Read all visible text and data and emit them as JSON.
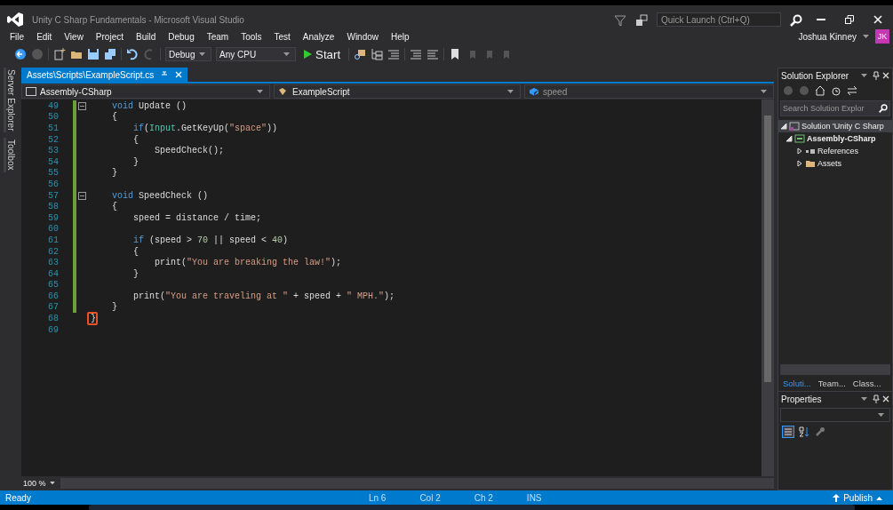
{
  "window": {
    "title": "Unity C Sharp Fundamentals - Microsoft Visual Studio",
    "quick_launch": {
      "placeholder": "Quick Launch (Ctrl+Q)"
    },
    "user": {
      "name": "Joshua Kinney",
      "initials": "JK"
    }
  },
  "menu": [
    "File",
    "Edit",
    "View",
    "Project",
    "Build",
    "Debug",
    "Team",
    "Tools",
    "Test",
    "Analyze",
    "Window",
    "Help"
  ],
  "toolbar": {
    "configuration": "Debug",
    "platform": "Any CPU",
    "start": "Start"
  },
  "side_tabs": [
    "Server Explorer",
    "Toolbox"
  ],
  "editor": {
    "tab": {
      "title": "Assets\\Scripts\\ExampleScript.cs",
      "selected": true
    },
    "nav": {
      "project": "Assembly-CSharp",
      "type": "ExampleScript",
      "member": "speed"
    },
    "lines": [
      {
        "number": "49",
        "fold": true,
        "changed": true,
        "highlighted": false,
        "tokens": [
          {
            "text": "    void",
            "kind": "keyword"
          },
          {
            "text": " Update ()",
            "kind": "plain"
          }
        ]
      },
      {
        "number": "50",
        "fold": false,
        "changed": true,
        "highlighted": false,
        "tokens": [
          {
            "text": "    {",
            "kind": "plain"
          }
        ]
      },
      {
        "number": "51",
        "fold": false,
        "changed": true,
        "highlighted": false,
        "tokens": [
          {
            "text": "        if",
            "kind": "keyword"
          },
          {
            "text": "(",
            "kind": "plain"
          },
          {
            "text": "Input",
            "kind": "type"
          },
          {
            "text": ".GetKeyUp(",
            "kind": "plain"
          },
          {
            "text": "\"space\"",
            "kind": "string"
          },
          {
            "text": "))",
            "kind": "plain"
          }
        ]
      },
      {
        "number": "52",
        "fold": false,
        "changed": true,
        "highlighted": false,
        "tokens": [
          {
            "text": "        {",
            "kind": "plain"
          }
        ]
      },
      {
        "number": "53",
        "fold": false,
        "changed": true,
        "highlighted": false,
        "tokens": [
          {
            "text": "            SpeedCheck();",
            "kind": "plain"
          }
        ]
      },
      {
        "number": "54",
        "fold": false,
        "changed": true,
        "highlighted": false,
        "tokens": [
          {
            "text": "        }",
            "kind": "plain"
          }
        ]
      },
      {
        "number": "55",
        "fold": false,
        "changed": true,
        "highlighted": false,
        "tokens": [
          {
            "text": "    }",
            "kind": "plain"
          }
        ]
      },
      {
        "number": "56",
        "fold": false,
        "changed": true,
        "highlighted": false
      },
      {
        "number": "57",
        "fold": true,
        "changed": true,
        "highlighted": false,
        "tokens": [
          {
            "text": "    void",
            "kind": "keyword"
          },
          {
            "text": " SpeedCheck ()",
            "kind": "plain"
          }
        ]
      },
      {
        "number": "58",
        "fold": false,
        "changed": true,
        "highlighted": false,
        "tokens": [
          {
            "text": "    {",
            "kind": "plain"
          }
        ]
      },
      {
        "number": "59",
        "fold": false,
        "changed": true,
        "highlighted": false,
        "tokens": [
          {
            "text": "        speed = distance / time;",
            "kind": "plain"
          }
        ]
      },
      {
        "number": "60",
        "fold": false,
        "changed": true,
        "highlighted": false
      },
      {
        "number": "61",
        "fold": false,
        "changed": true,
        "highlighted": false,
        "tokens": [
          {
            "text": "        if",
            "kind": "keyword"
          },
          {
            "text": " (speed > ",
            "kind": "plain"
          },
          {
            "text": "70",
            "kind": "number"
          },
          {
            "text": " || speed < ",
            "kind": "plain"
          },
          {
            "text": "40",
            "kind": "number"
          },
          {
            "text": ")",
            "kind": "plain"
          }
        ]
      },
      {
        "number": "62",
        "fold": false,
        "changed": true,
        "highlighted": false,
        "tokens": [
          {
            "text": "        {",
            "kind": "plain"
          }
        ]
      },
      {
        "number": "63",
        "fold": false,
        "changed": true,
        "highlighted": false,
        "tokens": [
          {
            "text": "            print(",
            "kind": "plain"
          },
          {
            "text": "\"You are breaking the law!\"",
            "kind": "string"
          },
          {
            "text": ");",
            "kind": "plain"
          }
        ]
      },
      {
        "number": "64",
        "fold": false,
        "changed": true,
        "highlighted": false,
        "tokens": [
          {
            "text": "        }",
            "kind": "plain"
          }
        ]
      },
      {
        "number": "65",
        "fold": false,
        "changed": true,
        "highlighted": false
      },
      {
        "number": "66",
        "fold": false,
        "changed": true,
        "highlighted": false,
        "tokens": [
          {
            "text": "        print(",
            "kind": "plain"
          },
          {
            "text": "\"You are traveling at \"",
            "kind": "string"
          },
          {
            "text": " + speed + ",
            "kind": "plain"
          },
          {
            "text": "\" MPH.\"",
            "kind": "string"
          },
          {
            "text": ");",
            "kind": "plain"
          }
        ]
      },
      {
        "number": "67",
        "fold": false,
        "changed": true,
        "highlighted": false,
        "tokens": [
          {
            "text": "    }",
            "kind": "plain"
          }
        ]
      },
      {
        "number": "68",
        "fold": false,
        "changed": false,
        "highlighted": true,
        "tokens": [
          {
            "text": "}",
            "kind": "plain"
          }
        ]
      },
      {
        "number": "69",
        "fold": false,
        "changed": false,
        "highlighted": false
      }
    ],
    "zoom": "100 %"
  },
  "solution_explorer": {
    "title": "Solution Explorer",
    "search": {
      "placeholder": "Search Solution Explor"
    },
    "tree": [
      {
        "label": "Solution 'Unity C Sharp",
        "kind": "solution",
        "selected": true,
        "children": [
          {
            "label": "Assembly-CSharp",
            "kind": "project",
            "selected": false,
            "expanded": true,
            "children": [
              {
                "label": "References",
                "kind": "references",
                "selected": false,
                "expanded": false
              },
              {
                "label": "Assets",
                "kind": "folder",
                "selected": false,
                "expanded": false
              }
            ]
          }
        ]
      }
    ],
    "tabs": [
      {
        "label": "Soluti...",
        "selected": true
      },
      {
        "label": "Team...",
        "selected": false
      },
      {
        "label": "Class...",
        "selected": false
      }
    ]
  },
  "properties": {
    "title": "Properties"
  },
  "status_bar": {
    "state": "Ready",
    "line": "Ln 6",
    "column": "Col 2",
    "char": "Ch 2",
    "mode": "INS",
    "publish": "Publish"
  }
}
